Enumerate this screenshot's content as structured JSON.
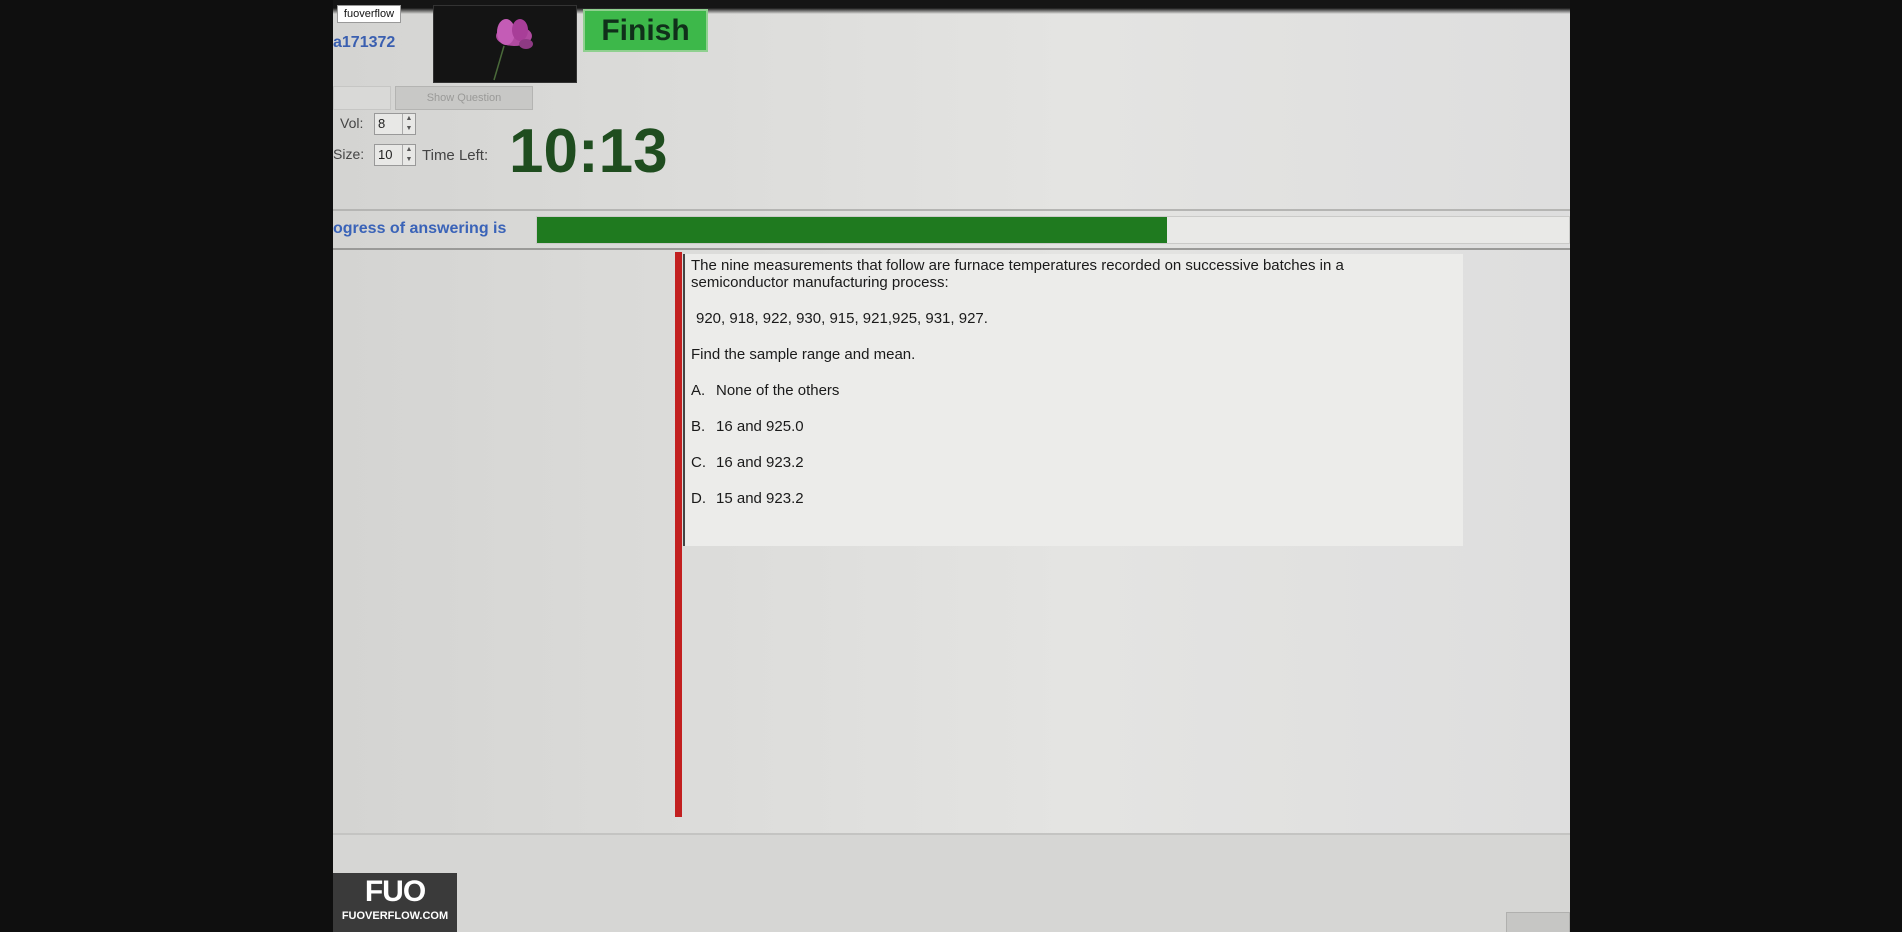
{
  "header": {
    "user_id": "a171372",
    "finish_label": "Finish",
    "show_question_label": "Show Question"
  },
  "controls": {
    "vol_label": "Vol:",
    "vol_value": "8",
    "size_label": "Size:",
    "size_value": "10",
    "time_left_label": "Time Left:",
    "timer": "10:13"
  },
  "progress": {
    "label": "ogress of answering is",
    "fraction": 0.61
  },
  "question": {
    "text": "The nine measurements that follow are furnace temperatures recorded  on successive batches in a semiconductor manufacturing process:",
    "data": "920, 918, 922, 930, 915, 921,925, 931, 927.",
    "prompt": "Find the sample range and mean.",
    "options": [
      {
        "letter": "A.",
        "text": "None of the others"
      },
      {
        "letter": "B.",
        "text": "16 and 925.0"
      },
      {
        "letter": "C.",
        "text": "16 and 923.2"
      },
      {
        "letter": "D.",
        "text": "15 and 923.2"
      }
    ]
  },
  "watermark": {
    "top_label": "fuoverflow",
    "logo_mark": "FUO",
    "logo_sub": "FUOVERFLOW.COM"
  },
  "colors": {
    "finish_bg": "#3db84a",
    "timer": "#1f4d1f",
    "progress_fill": "#1f7a1f",
    "progress_label": "#3a63b8",
    "answer_bar": "#c22020"
  },
  "icons": [
    "flower-image",
    "spin-up-icon",
    "spin-down-icon"
  ]
}
